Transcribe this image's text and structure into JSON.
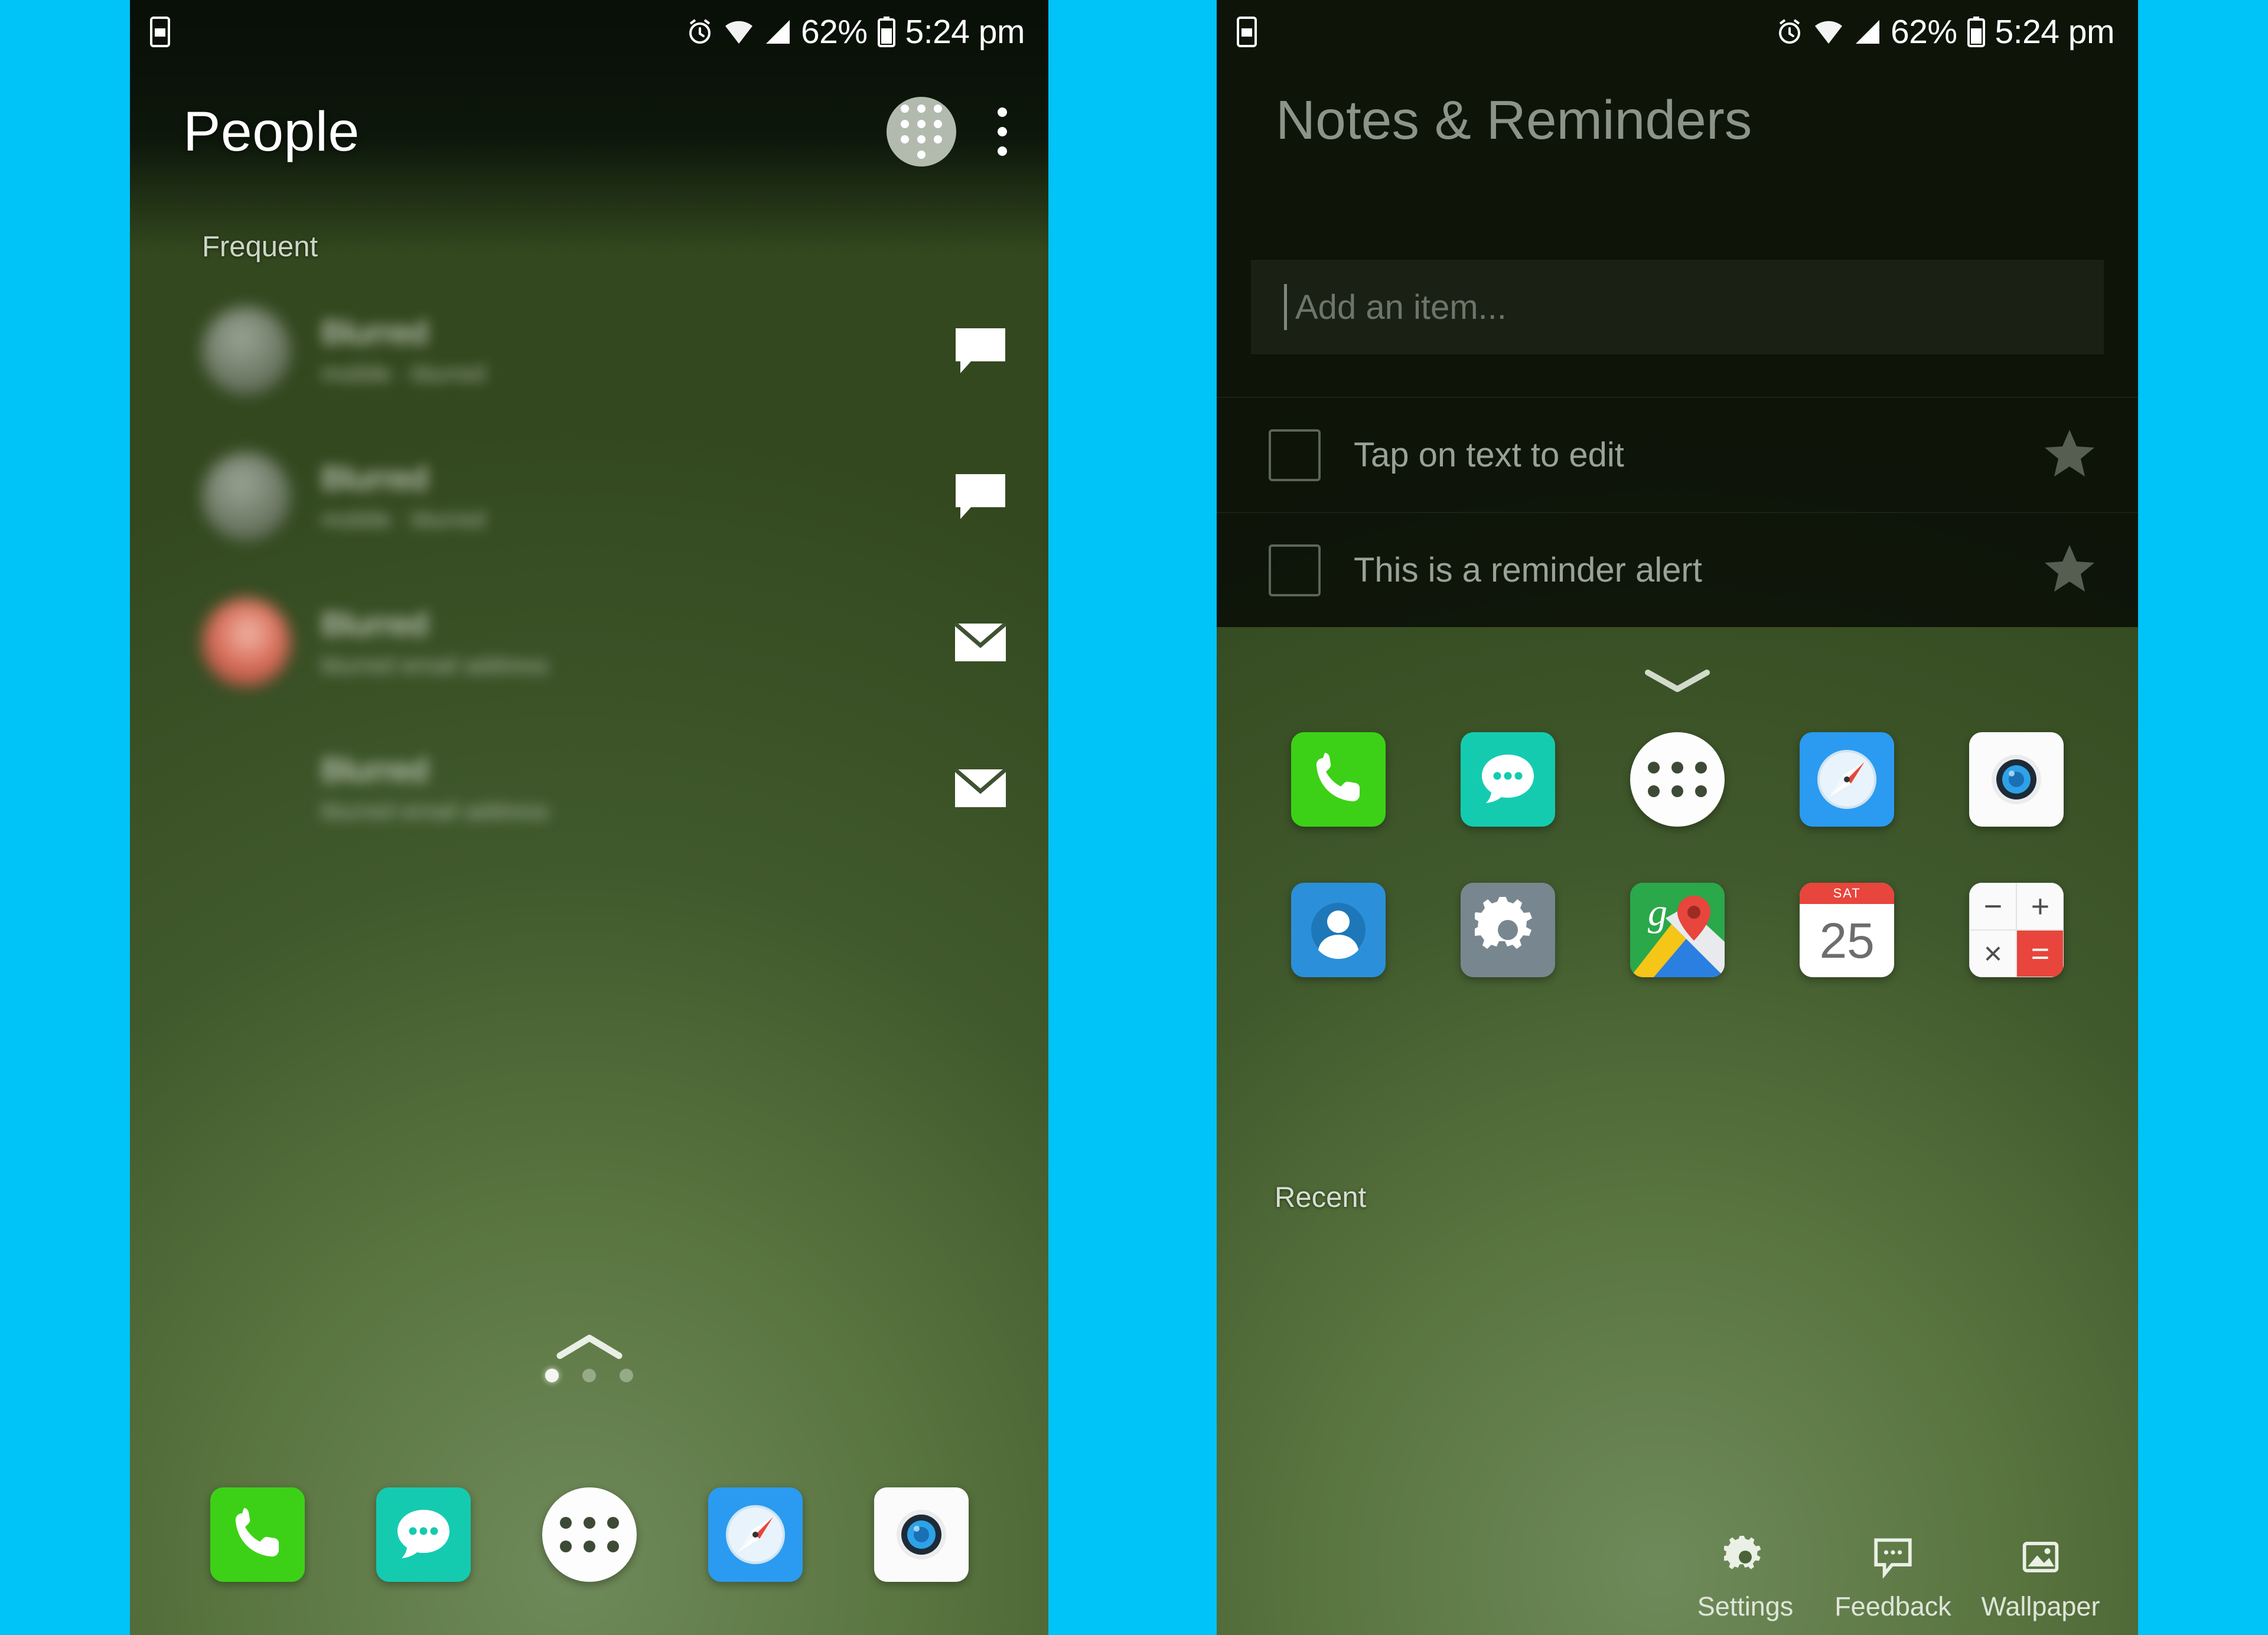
{
  "background_color": "#00c3f7",
  "status_bar": {
    "left_icons": [
      "screenshot-icon"
    ],
    "right_icons": [
      "alarm-icon",
      "wifi-icon",
      "signal-icon",
      "battery-icon"
    ],
    "battery_percent": "62%",
    "time": "5:24 pm"
  },
  "left_screen": {
    "app_title": "People",
    "dialpad_button": "dialpad",
    "overflow_button": "more-options",
    "section_label": "Frequent",
    "contacts": [
      {
        "name": "Blurred",
        "subtitle": "mobile · blurred",
        "avatar": "grey",
        "action_icon": "message-icon"
      },
      {
        "name": "Blurred",
        "subtitle": "mobile · blurred",
        "avatar": "grey",
        "action_icon": "message-icon"
      },
      {
        "name": "Blurred",
        "subtitle": "blurred email address",
        "avatar": "red",
        "action_icon": "email-icon"
      },
      {
        "name": "Blurred",
        "subtitle": "blurred email address",
        "avatar": "blue",
        "action_icon": "email-icon"
      }
    ],
    "page_indicator": {
      "total": 3,
      "active": 1
    },
    "dock": [
      {
        "name": "Phone",
        "icon": "phone-icon",
        "color": "#3cd116"
      },
      {
        "name": "Messages",
        "icon": "messages-icon",
        "color": "#14cbb0"
      },
      {
        "name": "App Drawer",
        "icon": "app-drawer-icon",
        "color": "#fdfdfd"
      },
      {
        "name": "Browser",
        "icon": "compass-icon",
        "color": "#2a9bf0"
      },
      {
        "name": "Camera",
        "icon": "camera-icon",
        "color": "#fbfbfb"
      }
    ]
  },
  "right_screen": {
    "app_title": "Notes & Reminders",
    "add_item_placeholder": "Add an item...",
    "notes": [
      {
        "text": "Tap on text to edit",
        "checked": false,
        "starred": false
      },
      {
        "text": "This is a reminder alert",
        "checked": false,
        "starred": false
      }
    ],
    "panel_handle": "collapse-panel",
    "apps_row1": [
      {
        "name": "Phone",
        "icon": "phone-icon"
      },
      {
        "name": "Messages",
        "icon": "messages-icon"
      },
      {
        "name": "App Drawer",
        "icon": "app-drawer-icon"
      },
      {
        "name": "Browser",
        "icon": "compass-icon"
      },
      {
        "name": "Camera",
        "icon": "camera-icon"
      }
    ],
    "apps_row2": [
      {
        "name": "Contacts",
        "icon": "contacts-icon"
      },
      {
        "name": "Settings",
        "icon": "gear-icon"
      },
      {
        "name": "Maps",
        "icon": "maps-icon"
      },
      {
        "name": "Calendar",
        "icon": "calendar-icon",
        "day_label": "SAT",
        "date": "25"
      },
      {
        "name": "Calculator",
        "icon": "calculator-icon",
        "keys": [
          "−",
          "+",
          "×",
          "="
        ]
      }
    ],
    "recent_label": "Recent",
    "bottom_bar": [
      {
        "label": "Settings",
        "icon": "gear-icon"
      },
      {
        "label": "Feedback",
        "icon": "feedback-icon"
      },
      {
        "label": "Wallpaper",
        "icon": "image-icon"
      }
    ]
  }
}
